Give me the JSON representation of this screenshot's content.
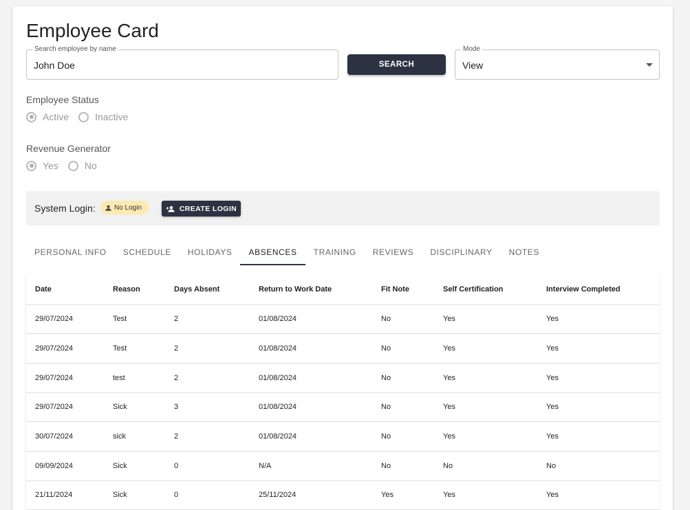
{
  "page": {
    "title": "Employee Card"
  },
  "search": {
    "label": "Search employee by name",
    "value": "John Doe",
    "button": "SEARCH"
  },
  "mode": {
    "label": "Mode",
    "value": "View"
  },
  "employee_status": {
    "label": "Employee Status",
    "options": [
      "Active",
      "Inactive"
    ],
    "selected": "Active"
  },
  "revenue_generator": {
    "label": "Revenue Generator",
    "options": [
      "Yes",
      "No"
    ],
    "selected": "Yes"
  },
  "system_login": {
    "label": "System Login:",
    "chip": "No Login",
    "button": "CREATE LOGIN"
  },
  "tabs": [
    "PERSONAL INFO",
    "SCHEDULE",
    "HOLIDAYS",
    "ABSENCES",
    "TRAINING",
    "REVIEWS",
    "DISCIPLINARY",
    "NOTES"
  ],
  "active_tab": "ABSENCES",
  "table": {
    "headers": [
      "Date",
      "Reason",
      "Days Absent",
      "Return to Work Date",
      "Fit Note",
      "Self Certification",
      "Interview Completed"
    ],
    "rows": [
      [
        "29/07/2024",
        "Test",
        "2",
        "01/08/2024",
        "No",
        "Yes",
        "Yes"
      ],
      [
        "29/07/2024",
        "Test",
        "2",
        "01/08/2024",
        "No",
        "Yes",
        "Yes"
      ],
      [
        "29/07/2024",
        "test",
        "2",
        "01/08/2024",
        "No",
        "Yes",
        "Yes"
      ],
      [
        "29/07/2024",
        "Sick",
        "3",
        "01/08/2024",
        "No",
        "Yes",
        "Yes"
      ],
      [
        "30/07/2024",
        "sick",
        "2",
        "01/08/2024",
        "No",
        "Yes",
        "Yes"
      ],
      [
        "09/09/2024",
        "Sick",
        "0",
        "N/A",
        "No",
        "No",
        "No"
      ],
      [
        "21/11/2024",
        "Sick",
        "0",
        "25/11/2024",
        "Yes",
        "Yes",
        "Yes"
      ]
    ]
  },
  "colors": {
    "primary_dark": "#2c3242",
    "chip_bg": "#fbeab1",
    "login_bar_bg": "#f1f1f1"
  }
}
